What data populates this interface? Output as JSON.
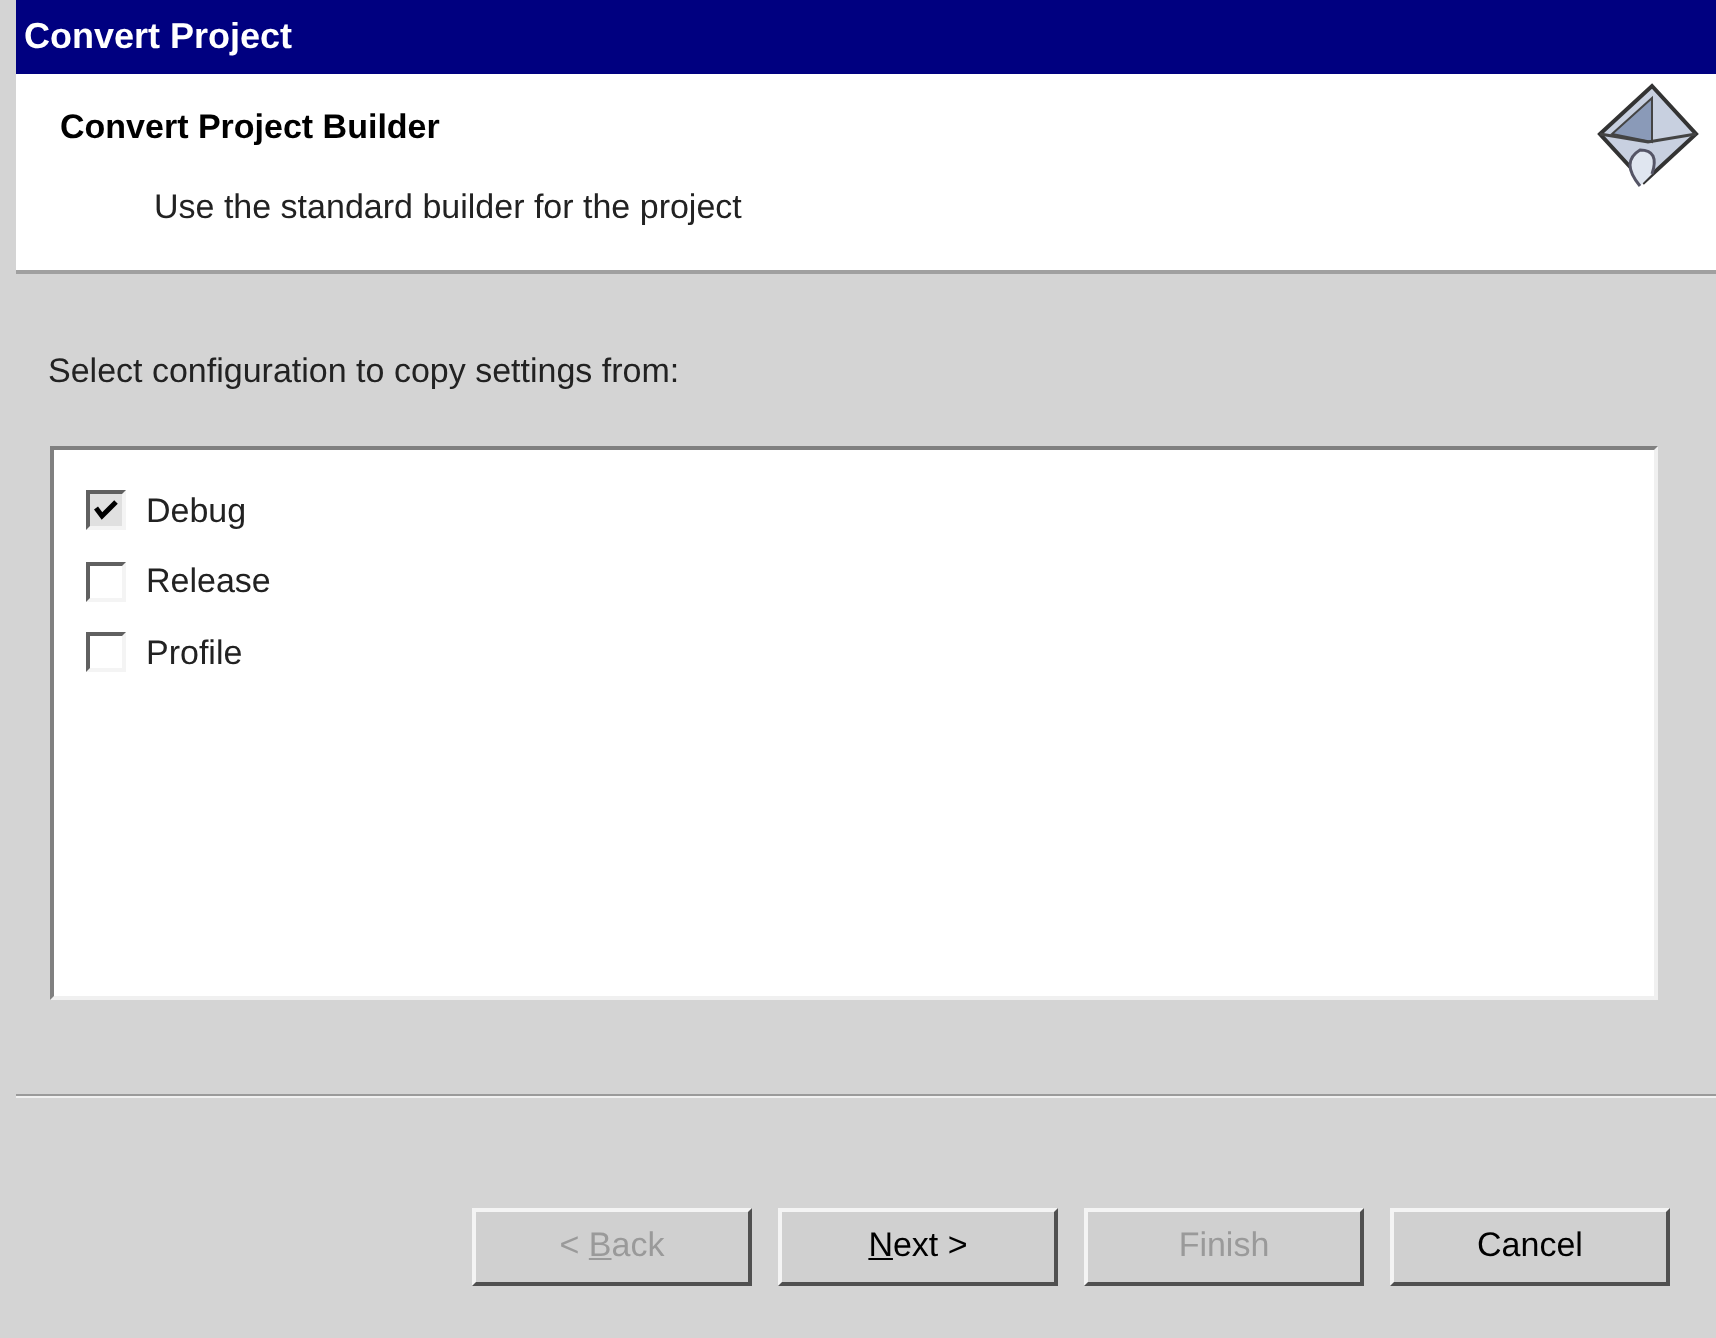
{
  "window": {
    "title": "Convert Project"
  },
  "header": {
    "title": "Convert Project Builder",
    "description": "Use the standard builder for the project"
  },
  "prompt": "Select configuration to copy settings from:",
  "configurations": [
    {
      "label": "Debug",
      "checked": true
    },
    {
      "label": "Release",
      "checked": false
    },
    {
      "label": "Profile",
      "checked": false
    }
  ],
  "buttons": [
    {
      "before": "< ",
      "mnemonic": "B",
      "after": "ack",
      "disabled": true
    },
    {
      "mnemonic": "N",
      "after": "ext >",
      "disabled": false
    },
    {
      "before": "Finish",
      "disabled": true
    },
    {
      "before": "Cancel",
      "disabled": false
    }
  ]
}
